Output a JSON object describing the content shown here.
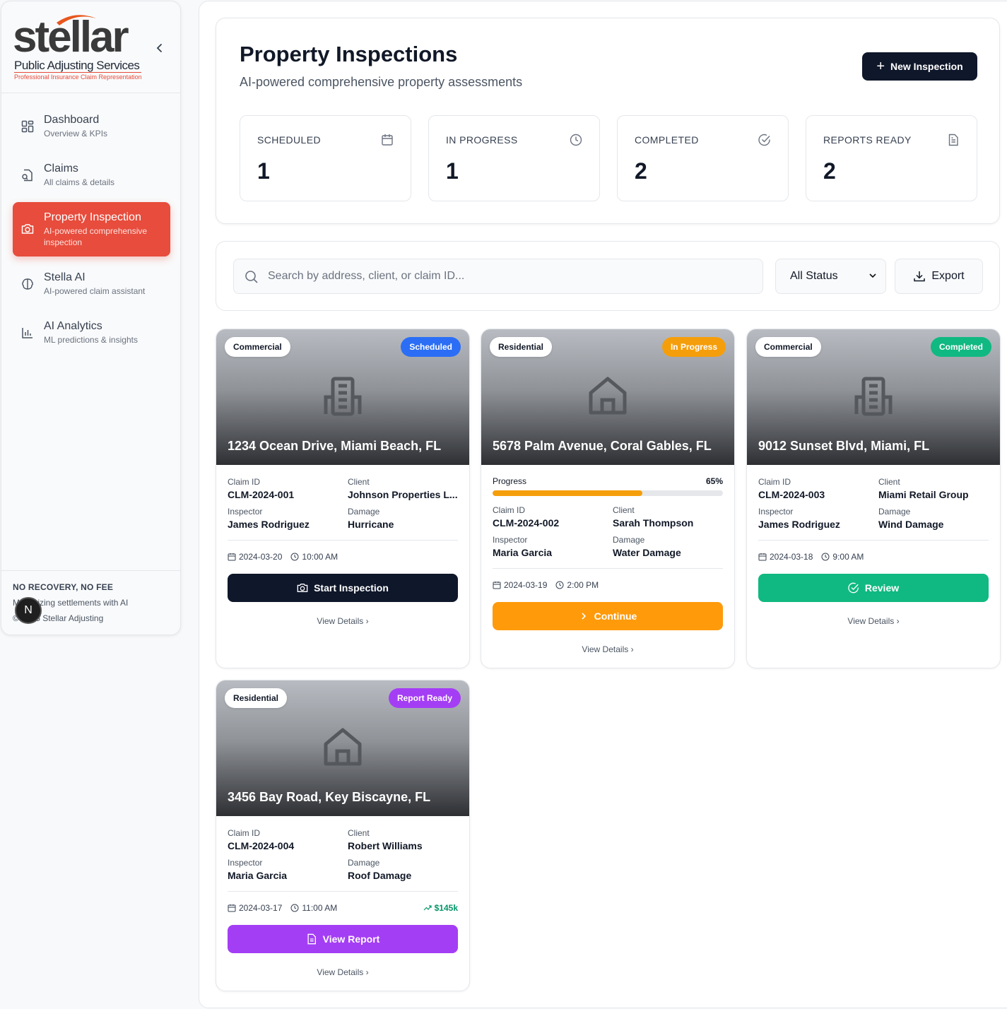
{
  "logo": {
    "wordmark": "stellar",
    "line1": "Public Adjusting Services",
    "line2": "Professional Insurance Claim Representation"
  },
  "sidebar": {
    "collapse_icon": "chevron-left-icon",
    "items": [
      {
        "title": "Dashboard",
        "sub": "Overview & KPIs",
        "icon": "dashboard-grid-icon"
      },
      {
        "title": "Claims",
        "sub": "All claims & details",
        "icon": "file-search-icon"
      },
      {
        "title": "Property Inspection",
        "sub": "AI-powered comprehensive inspection",
        "icon": "camera-icon",
        "active": true
      },
      {
        "title": "Stella AI",
        "sub": "AI-powered claim assistant",
        "icon": "brain-icon"
      },
      {
        "title": "AI Analytics",
        "sub": "ML predictions & insights",
        "icon": "bar-chart-icon"
      }
    ],
    "footer": {
      "tagline": "NO RECOVERY, NO FEE",
      "line2": "Maximizing settlements with AI",
      "line3": "© 2025 Stellar Adjusting"
    },
    "dev_badge": "N"
  },
  "header": {
    "title": "Property Inspections",
    "subtitle": "AI-powered comprehensive property assessments",
    "new_button": "New Inspection"
  },
  "stats": [
    {
      "label": "SCHEDULED",
      "value": "1",
      "icon": "calendar-icon"
    },
    {
      "label": "IN PROGRESS",
      "value": "1",
      "icon": "clock-icon"
    },
    {
      "label": "COMPLETED",
      "value": "2",
      "icon": "check-circle-icon"
    },
    {
      "label": "REPORTS READY",
      "value": "2",
      "icon": "document-icon"
    }
  ],
  "filters": {
    "search_placeholder": "Search by address, client, or claim ID...",
    "status_selected": "All Status",
    "export_label": "Export"
  },
  "labels": {
    "claim_id": "Claim ID",
    "client": "Client",
    "inspector": "Inspector",
    "damage": "Damage",
    "progress": "Progress",
    "view_details": "View Details"
  },
  "colors": {
    "brand": "#e74c3c",
    "scheduled": "#2b6ef5",
    "in_progress": "#f59e0b",
    "completed": "#10b981",
    "report_ready": "#a43ef5",
    "dark": "#0f172a"
  },
  "inspections": [
    {
      "type": "Commercial",
      "status": "Scheduled",
      "address": "1234 Ocean Drive, Miami Beach, FL",
      "claim_id": "CLM-2024-001",
      "client": "Johnson Properties L...",
      "inspector": "James Rodriguez",
      "damage": "Hurricane",
      "date": "2024-03-20",
      "time": "10:00 AM",
      "action": "Start Inspection",
      "building_icon": "office-building-icon"
    },
    {
      "type": "Residential",
      "status": "In Progress",
      "address": "5678 Palm Avenue, Coral Gables, FL",
      "progress": "65%",
      "progress_value": 0.65,
      "claim_id": "CLM-2024-002",
      "client": "Sarah Thompson",
      "inspector": "Maria Garcia",
      "damage": "Water Damage",
      "date": "2024-03-19",
      "time": "2:00 PM",
      "action": "Continue",
      "building_icon": "house-icon"
    },
    {
      "type": "Commercial",
      "status": "Completed",
      "address": "9012 Sunset Blvd, Miami, FL",
      "claim_id": "CLM-2024-003",
      "client": "Miami Retail Group",
      "inspector": "James Rodriguez",
      "damage": "Wind Damage",
      "date": "2024-03-18",
      "time": "9:00 AM",
      "action": "Review",
      "building_icon": "office-building-icon"
    },
    {
      "type": "Residential",
      "status": "Report Ready",
      "address": "3456 Bay Road, Key Biscayne, FL",
      "claim_id": "CLM-2024-004",
      "client": "Robert Williams",
      "inspector": "Maria Garcia",
      "damage": "Roof Damage",
      "date": "2024-03-17",
      "time": "11:00 AM",
      "estimate": "$145k",
      "action": "View Report",
      "building_icon": "house-icon"
    }
  ]
}
